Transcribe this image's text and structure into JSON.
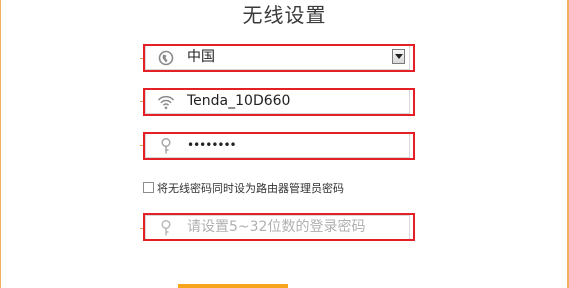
{
  "page": {
    "title": "无线设置"
  },
  "region_select": {
    "icon": "globe-icon",
    "value": "中国"
  },
  "ssid_field": {
    "icon": "wifi-icon",
    "value": "Tenda_10D660"
  },
  "wifi_password_field": {
    "icon": "key-icon",
    "value": "••••••••"
  },
  "sync_password": {
    "label": "将无线密码同时设为路由器管理员密码",
    "checked": false
  },
  "login_password_field": {
    "icon": "key-icon",
    "placeholder": "请设置5~32位数的登录密码"
  },
  "colors": {
    "highlight": "#e41f26",
    "accent": "#f8a51e",
    "frame": "#f2b15c"
  }
}
